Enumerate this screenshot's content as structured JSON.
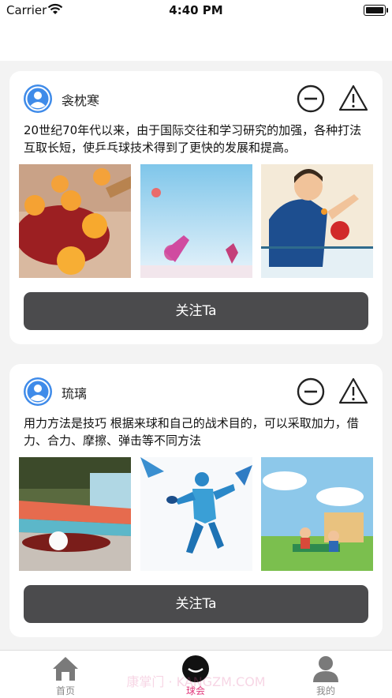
{
  "status_bar": {
    "carrier": "Carrier",
    "time": "4:40 PM"
  },
  "posts": [
    {
      "username": "衾枕寒",
      "text": "20世纪70年代以来，由于国际交往和学习研究的加强，各种打法互取长短，使乒乓球技术得到了更快的发展和提高。",
      "follow_label": "关注Ta"
    },
    {
      "username": "琉璃",
      "text": "用力方法是技巧 根据来球和自己的战术目的，可以采取加力，借力、合力、摩擦、弹击等不同方法",
      "follow_label": "关注Ta"
    }
  ],
  "tab_bar": {
    "items": [
      {
        "label": "首页",
        "icon": "home-icon"
      },
      {
        "label": "球会",
        "icon": "ping-pong-ball-icon"
      },
      {
        "label": "我的",
        "icon": "person-icon"
      }
    ],
    "active_color": "#e13a7c"
  },
  "watermark": "康掌门 · KANGZM.COM"
}
